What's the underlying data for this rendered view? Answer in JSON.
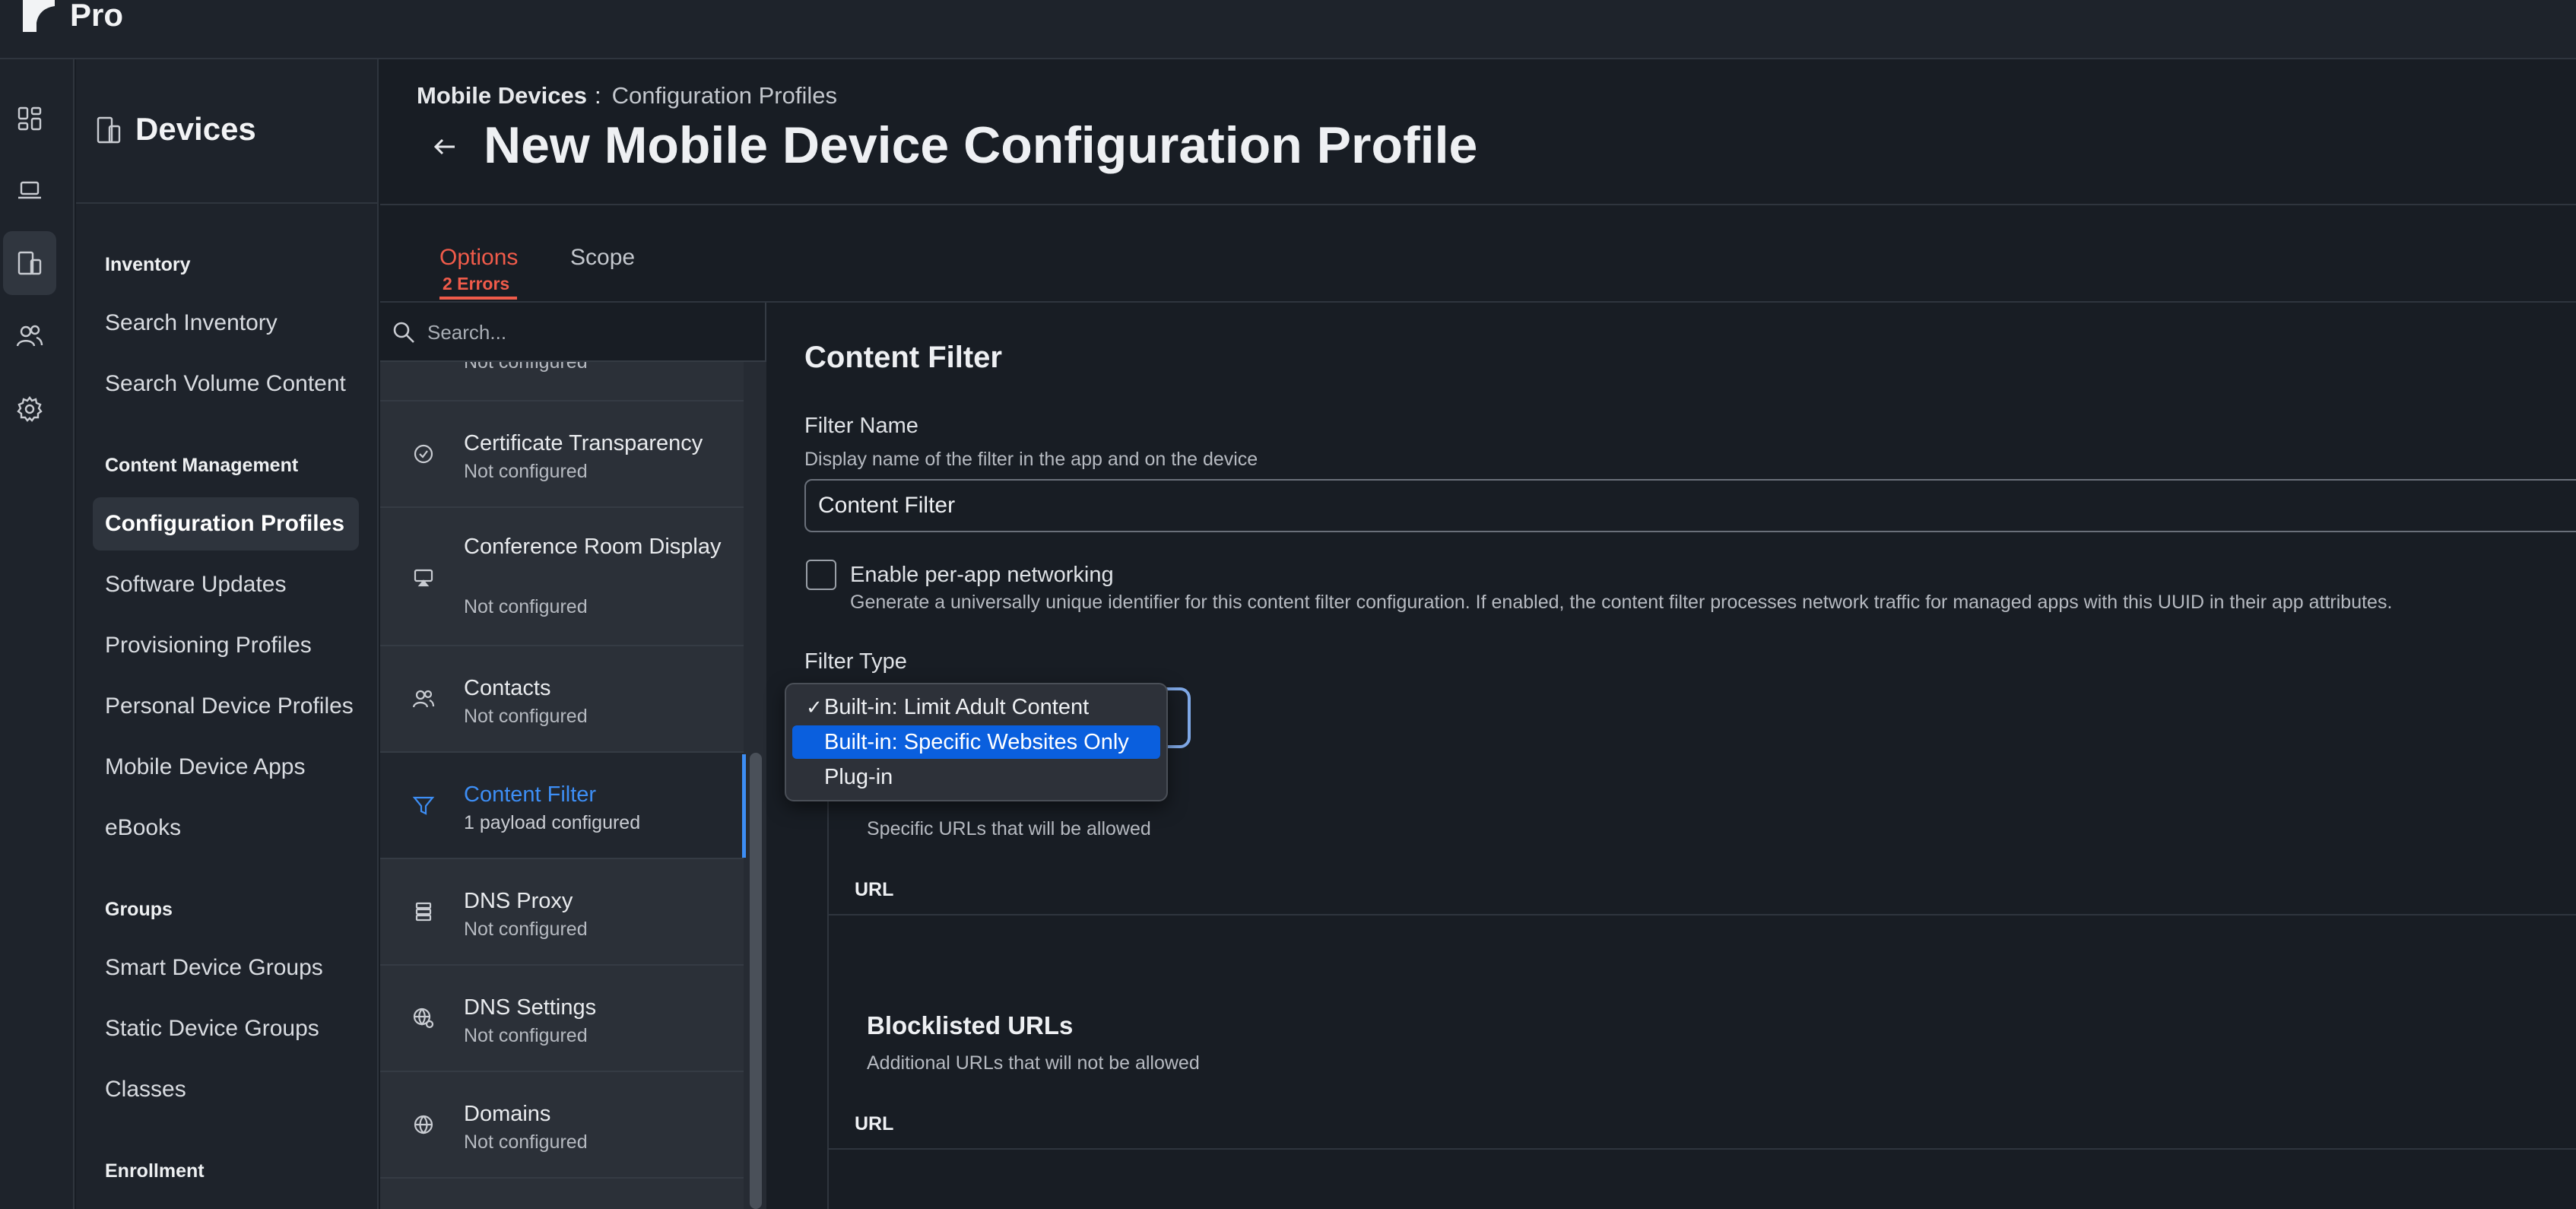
{
  "app": {
    "name": "Pro"
  },
  "rail": {
    "items": [
      {
        "name": "dashboard"
      },
      {
        "name": "computers"
      },
      {
        "name": "devices",
        "active": true
      },
      {
        "name": "users"
      },
      {
        "name": "settings"
      }
    ]
  },
  "sidebar": {
    "title": "Devices",
    "sections": [
      {
        "label": "Inventory",
        "items": [
          "Search Inventory",
          "Search Volume Content"
        ]
      },
      {
        "label": "Content Management",
        "items": [
          "Configuration Profiles",
          "Software Updates",
          "Provisioning Profiles",
          "Personal Device Profiles",
          "Mobile Device Apps",
          "eBooks"
        ],
        "active": "Configuration Profiles"
      },
      {
        "label": "Groups",
        "items": [
          "Smart Device Groups",
          "Static Device Groups",
          "Classes"
        ]
      },
      {
        "label": "Enrollment",
        "items": []
      }
    ]
  },
  "breadcrumb": {
    "parent": "Mobile Devices",
    "separator": ":",
    "current": "Configuration Profiles"
  },
  "page_title": "New Mobile Device Configuration Profile",
  "tabs": {
    "options": {
      "label": "Options",
      "errors": "2 Errors"
    },
    "scope": {
      "label": "Scope"
    }
  },
  "payloads": {
    "search_placeholder": "Search...",
    "partial_status": "Not configured",
    "items": [
      {
        "name": "Certificate Transparency",
        "status": "Not configured",
        "icon": "check-circle-icon"
      },
      {
        "name": "Conference Room Display",
        "status": "Not configured",
        "icon": "display-icon"
      },
      {
        "name": "Contacts",
        "status": "Not configured",
        "icon": "contacts-icon"
      },
      {
        "name": "Content Filter",
        "status": "1 payload configured",
        "icon": "filter-icon",
        "active": true
      },
      {
        "name": "DNS Proxy",
        "status": "Not configured",
        "icon": "server-icon"
      },
      {
        "name": "DNS Settings",
        "status": "Not configured",
        "icon": "globe-gear-icon"
      },
      {
        "name": "Domains",
        "status": "Not configured",
        "icon": "globe-icon"
      }
    ]
  },
  "content": {
    "title": "Content Filter",
    "filter_name": {
      "label": "Filter Name",
      "help": "Display name of the filter in the app and on the device",
      "value": "Content Filter"
    },
    "per_app": {
      "label": "Enable per-app networking",
      "help": "Generate a universally unique identifier for this content filter configuration. If enabled, the content filter processes network traffic for managed apps with this UUID in their app attributes.",
      "checked": false
    },
    "filter_type": {
      "label": "Filter Type",
      "options": [
        "Built-in: Limit Adult Content",
        "Built-in: Specific Websites Only",
        "Plug-in"
      ],
      "selected": "Built-in: Limit Adult Content",
      "highlighted": "Built-in: Specific Websites Only"
    },
    "allowed": {
      "help": "Specific URLs that will be allowed",
      "column": "URL"
    },
    "blocklisted": {
      "title": "Blocklisted URLs",
      "help": "Additional URLs that will not be allowed",
      "column": "URL"
    }
  },
  "colors": {
    "accent": "#3d8ef5",
    "error": "#f05b4a",
    "highlight": "#0a5fde",
    "background": "#181d24"
  }
}
